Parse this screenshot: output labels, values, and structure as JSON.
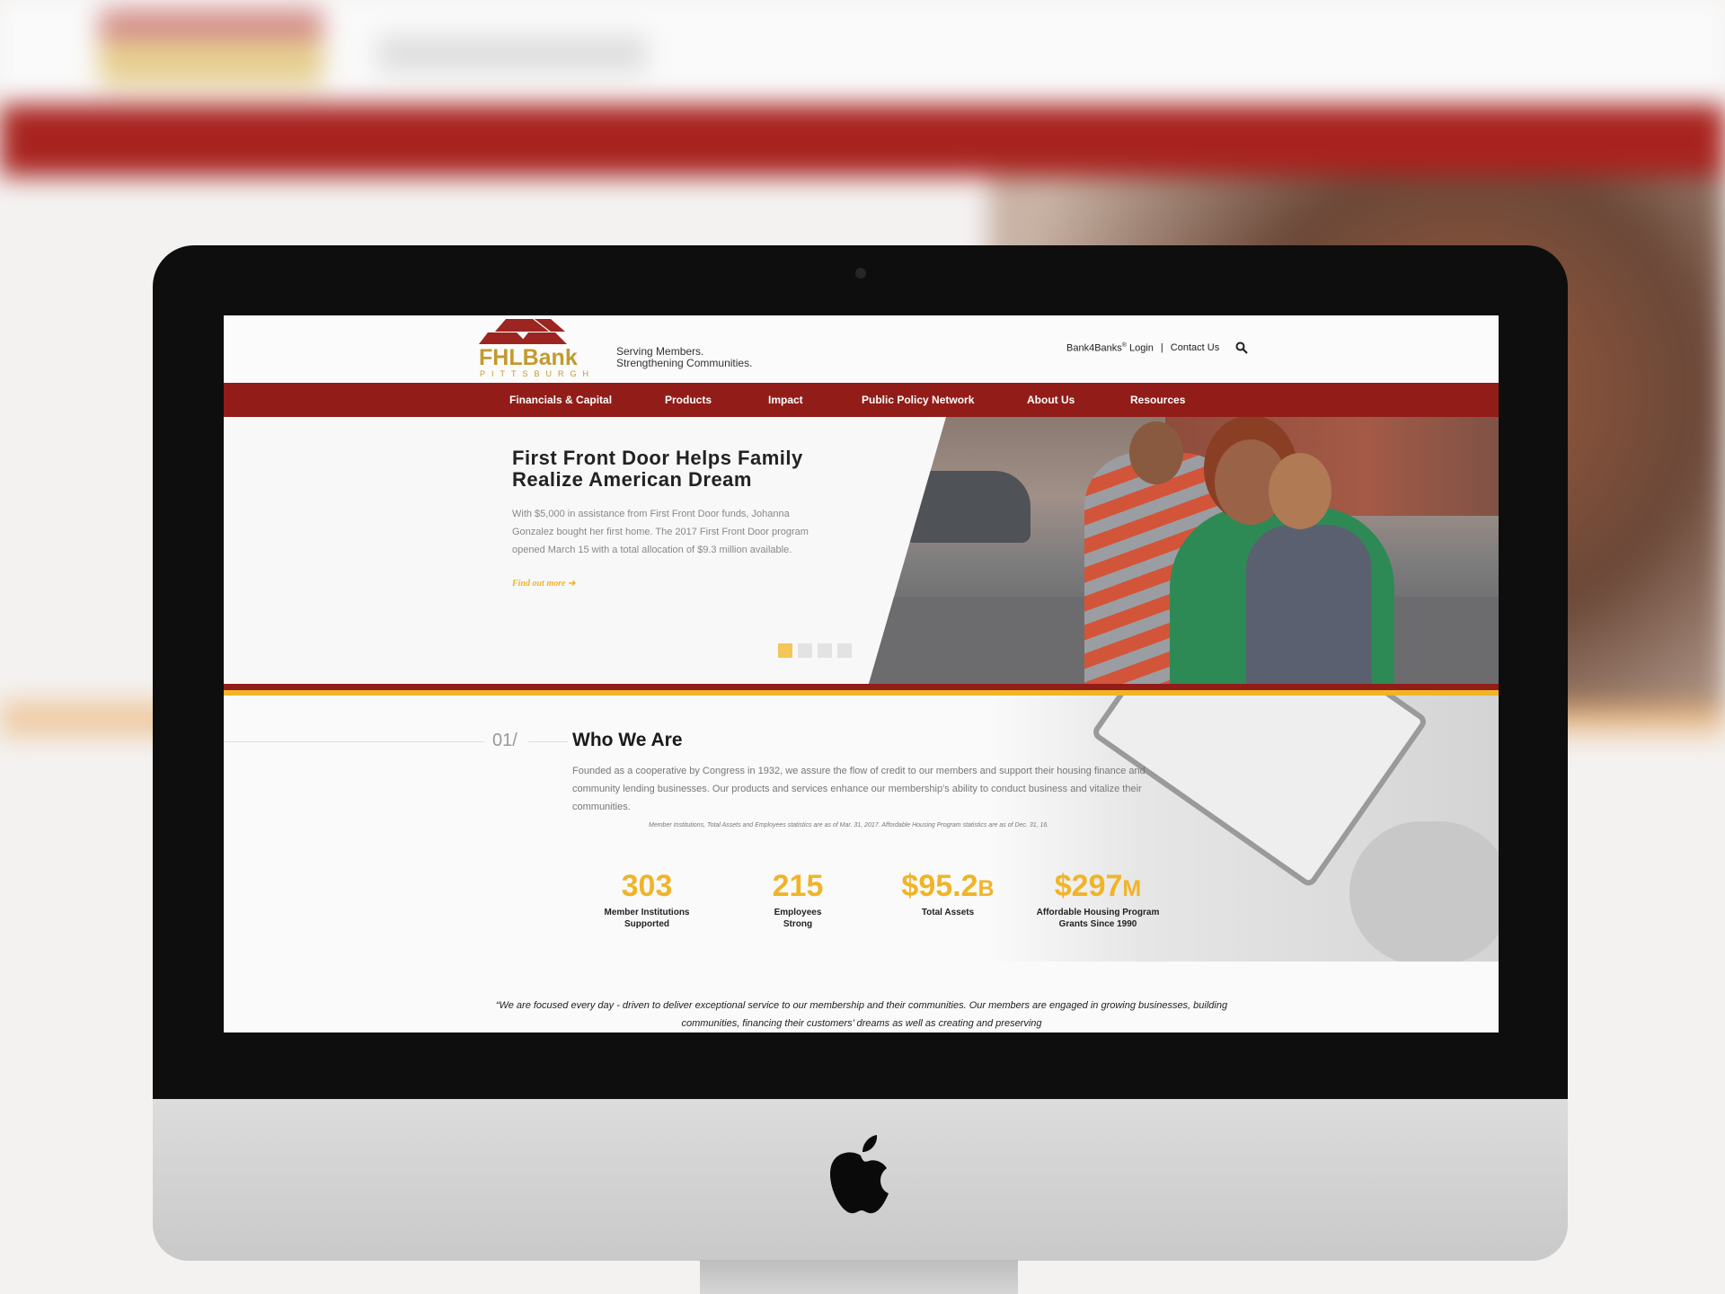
{
  "brand": {
    "name": "FHLBank",
    "location": "PITTSBURGH",
    "tagline_1": "Serving Members.",
    "tagline_2": "Strengthening Communities.",
    "colors": {
      "primary": "#921c18",
      "accent": "#f0b429",
      "logo_gold": "#c39a2d"
    }
  },
  "top_links": {
    "login": "Bank4Banks",
    "login_sup": "®",
    "login_suffix": " Login",
    "separator": "|",
    "contact": "Contact Us",
    "search_icon": "search-icon"
  },
  "nav": [
    "Financials & Capital",
    "Products",
    "Impact",
    "Public Policy Network",
    "About Us",
    "Resources"
  ],
  "hero": {
    "title": "First Front Door Helps Family Realize American Dream",
    "text": "With $5,000 in assistance from First Front Door funds, Johanna Gonzalez bought her first home. The 2017 First Front Door program opened March 15 with a total allocation of $9.3 million available.",
    "link": "Find out more",
    "link_icon": "arrow-right-icon",
    "slides": 4,
    "active_slide": 1
  },
  "who": {
    "number": "01/",
    "title": "Who We Are",
    "text": "Founded as a cooperative by Congress in 1932, we assure the flow of credit to our members and support their housing finance and community lending businesses. Our products and services enhance our membership's ability to conduct business and vitalize their communities.",
    "note": "Member Institutions, Total Assets and Employees statistics are as of Mar. 31, 2017.  Affordable Housing Program statistics are as of Dec. 31, 16.",
    "stats": [
      {
        "value": "303",
        "unit": "",
        "label_1": "Member Institutions",
        "label_2": "Supported"
      },
      {
        "value": "215",
        "unit": "",
        "label_1": "Employees",
        "label_2": "Strong"
      },
      {
        "value": "$95.2",
        "unit": "B",
        "label_1": "Total Assets",
        "label_2": ""
      },
      {
        "value": "$297",
        "unit": "M",
        "label_1": "Affordable Housing Program",
        "label_2": "Grants Since 1990"
      }
    ]
  },
  "quote": "“We are focused every day - driven to deliver exceptional service to our membership and their communities. Our members are engaged in growing businesses, building communities, financing their customers’ dreams as well as creating and preserving"
}
